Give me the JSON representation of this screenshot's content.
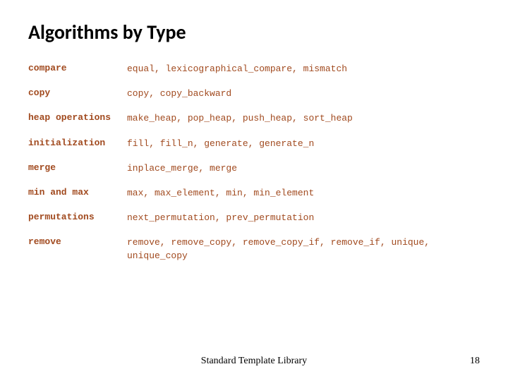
{
  "title": "Algorithms by Type",
  "rows": [
    {
      "category": "compare",
      "items": "equal, lexicographical_compare, mismatch"
    },
    {
      "category": "copy",
      "items": "copy, copy_backward"
    },
    {
      "category": "heap operations",
      "items": "make_heap, pop_heap, push_heap, sort_heap"
    },
    {
      "category": "initialization",
      "items": "fill, fill_n, generate, generate_n"
    },
    {
      "category": "merge",
      "items": "inplace_merge, merge"
    },
    {
      "category": "min and max",
      "items": "max, max_element, min, min_element"
    },
    {
      "category": "permutations",
      "items": "next_permutation, prev_permutation"
    },
    {
      "category": "remove",
      "items": "remove, remove_copy, remove_copy_if, remove_if, unique, unique_copy"
    }
  ],
  "footer": "Standard Template Library",
  "page_number": "18"
}
